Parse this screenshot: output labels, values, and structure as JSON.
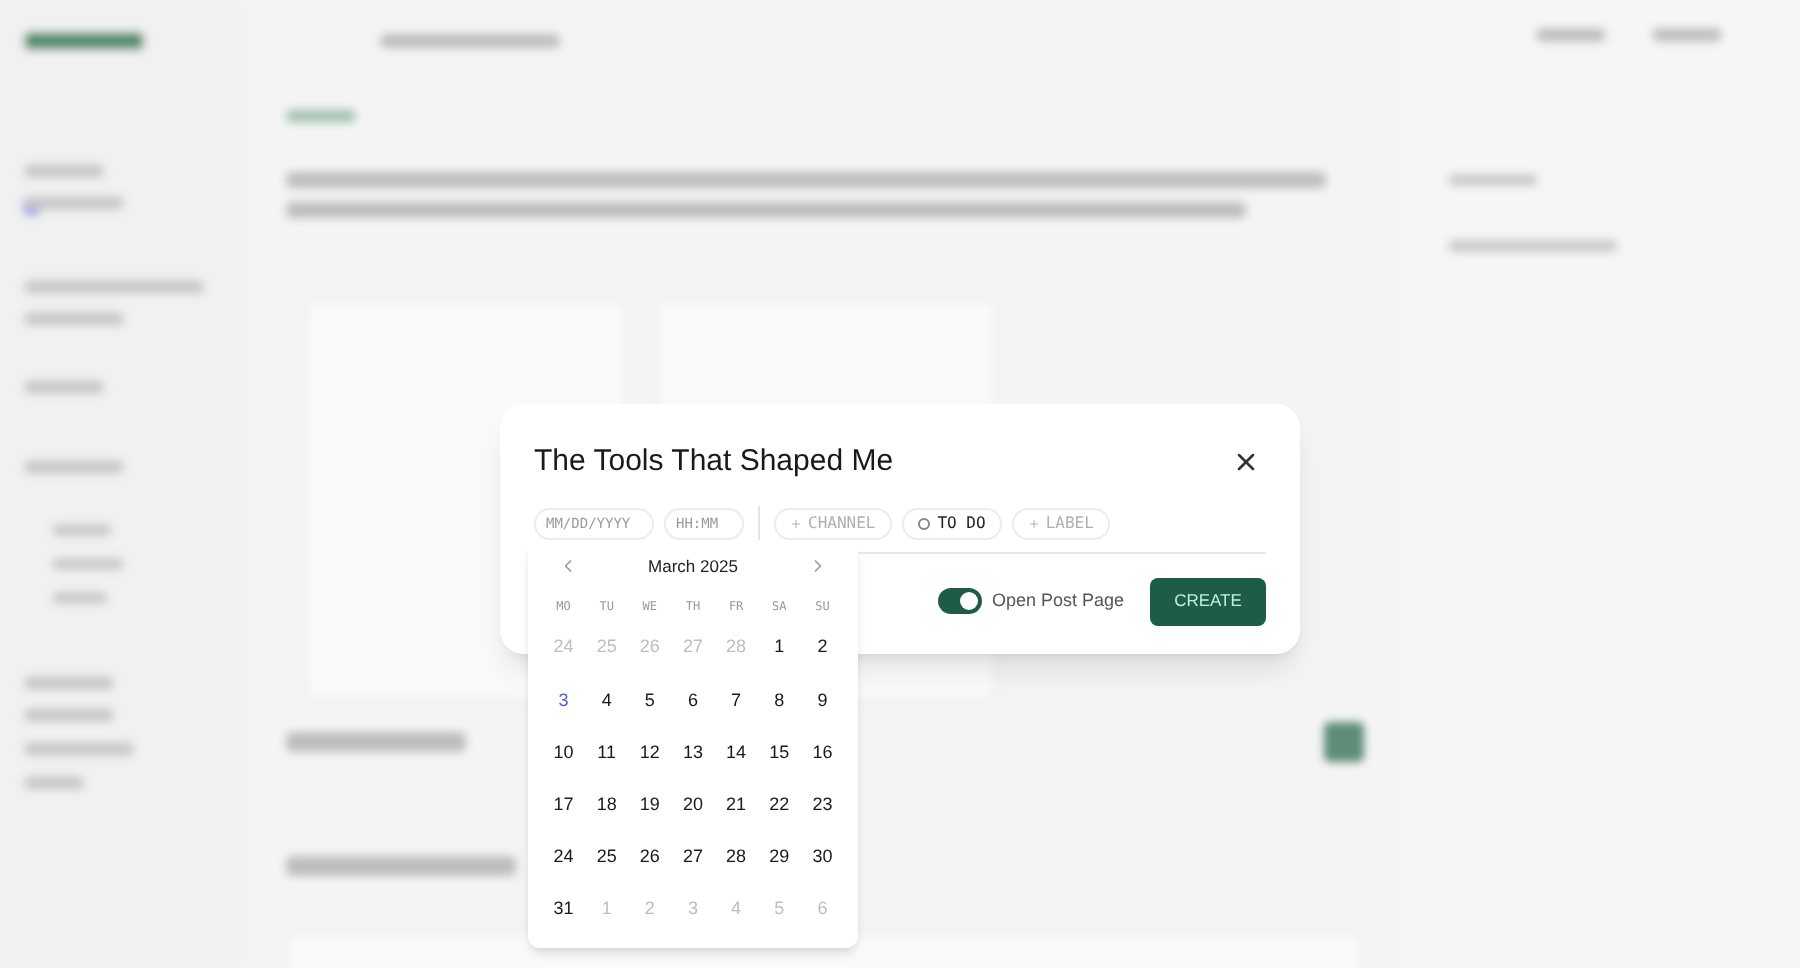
{
  "dialog": {
    "title": "The Tools That Shaped Me",
    "fields": [
      {
        "kind": "field",
        "placeholder": "MM/DD/YYYY"
      },
      {
        "kind": "field",
        "placeholder": "HH:MM"
      },
      {
        "kind": "add",
        "label": "CHANNEL"
      },
      {
        "kind": "status",
        "label": "TO DO"
      },
      {
        "kind": "add",
        "label": "LABEL"
      }
    ],
    "toggle": {
      "label": "Open Post Page",
      "on": true
    },
    "create_button": "CREATE"
  },
  "calendar": {
    "month": "March 2025",
    "weekdays": [
      "MO",
      "TU",
      "WE",
      "TH",
      "FR",
      "SA",
      "SU"
    ],
    "days": [
      {
        "label": "24",
        "outside": true,
        "today": false
      },
      {
        "label": "25",
        "outside": true,
        "today": false
      },
      {
        "label": "26",
        "outside": true,
        "today": false
      },
      {
        "label": "27",
        "outside": true,
        "today": false
      },
      {
        "label": "28",
        "outside": true,
        "today": false
      },
      {
        "label": "1",
        "outside": false,
        "today": false
      },
      {
        "label": "2",
        "outside": false,
        "today": false
      },
      {
        "label": "3",
        "outside": false,
        "today": true
      },
      {
        "label": "4",
        "outside": false,
        "today": false
      },
      {
        "label": "5",
        "outside": false,
        "today": false
      },
      {
        "label": "6",
        "outside": false,
        "today": false
      },
      {
        "label": "7",
        "outside": false,
        "today": false
      },
      {
        "label": "8",
        "outside": false,
        "today": false
      },
      {
        "label": "9",
        "outside": false,
        "today": false
      },
      {
        "label": "10",
        "outside": false,
        "today": false
      },
      {
        "label": "11",
        "outside": false,
        "today": false
      },
      {
        "label": "12",
        "outside": false,
        "today": false
      },
      {
        "label": "13",
        "outside": false,
        "today": false
      },
      {
        "label": "14",
        "outside": false,
        "today": false
      },
      {
        "label": "15",
        "outside": false,
        "today": false
      },
      {
        "label": "16",
        "outside": false,
        "today": false
      },
      {
        "label": "17",
        "outside": false,
        "today": false
      },
      {
        "label": "18",
        "outside": false,
        "today": false
      },
      {
        "label": "19",
        "outside": false,
        "today": false
      },
      {
        "label": "20",
        "outside": false,
        "today": false
      },
      {
        "label": "21",
        "outside": false,
        "today": false
      },
      {
        "label": "22",
        "outside": false,
        "today": false
      },
      {
        "label": "23",
        "outside": false,
        "today": false
      },
      {
        "label": "24",
        "outside": false,
        "today": false
      },
      {
        "label": "25",
        "outside": false,
        "today": false
      },
      {
        "label": "26",
        "outside": false,
        "today": false
      },
      {
        "label": "27",
        "outside": false,
        "today": false
      },
      {
        "label": "28",
        "outside": false,
        "today": false
      },
      {
        "label": "29",
        "outside": false,
        "today": false
      },
      {
        "label": "30",
        "outside": false,
        "today": false
      },
      {
        "label": "31",
        "outside": false,
        "today": false
      },
      {
        "label": "1",
        "outside": true,
        "today": false
      },
      {
        "label": "2",
        "outside": true,
        "today": false
      },
      {
        "label": "3",
        "outside": true,
        "today": false
      },
      {
        "label": "4",
        "outside": true,
        "today": false
      },
      {
        "label": "5",
        "outside": true,
        "today": false
      },
      {
        "label": "6",
        "outside": true,
        "today": false
      }
    ]
  }
}
